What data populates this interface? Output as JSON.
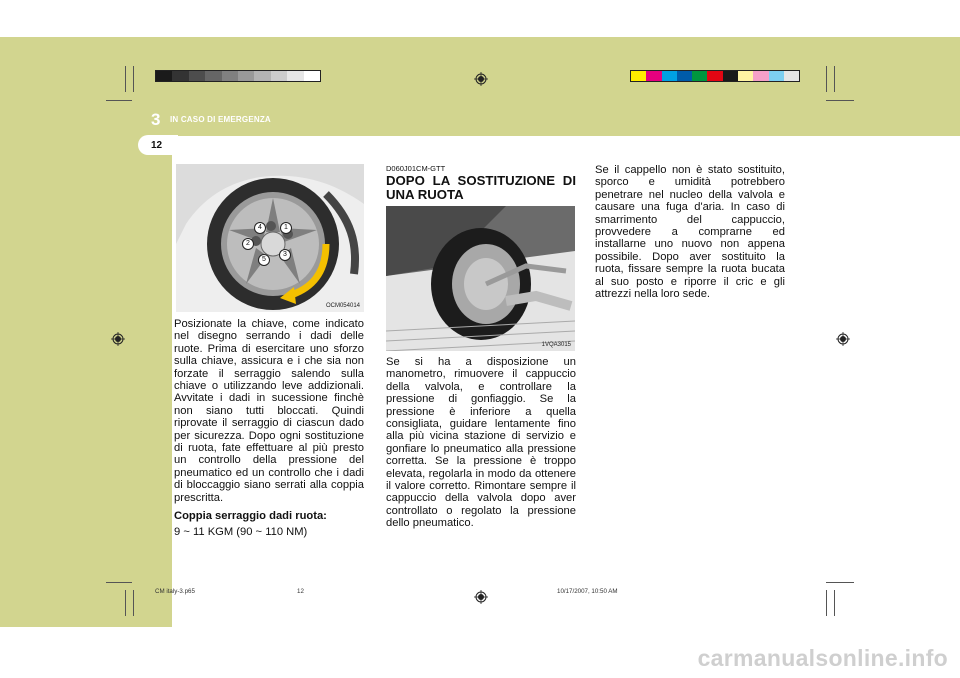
{
  "header": {
    "chapter_number": "3",
    "chapter_title": "IN CASO DI EMERGENZA",
    "page_number": "12"
  },
  "color_bar_left": [
    "#1a1a1a",
    "#333333",
    "#4d4d4d",
    "#666666",
    "#808080",
    "#999999",
    "#b3b3b3",
    "#cccccc",
    "#e6e6e6",
    "#ffffff"
  ],
  "color_bar_right": [
    "#ffed00",
    "#e5007e",
    "#00a0e3",
    "#005ba9",
    "#00963f",
    "#e30613",
    "#1a1a1a",
    "#fff4a3",
    "#f5a0c8",
    "#7dcff1",
    "#e6e6e6"
  ],
  "column1": {
    "figure_label": "OCM054014",
    "body": "Posizionate la chiave, come indicato nel disegno serrando i dadi delle ruote. Prima di esercitare uno sforzo sulla chiave, assicura e i che sia non forzate il serraggio salendo sulla chiave o utilizzando leve addizionali. Avvitate i dadi in sucessione finchè non siano tutti bloccati. Quindi riprovate il serraggio di ciascun dado per sicurezza. Dopo ogni sostituzione di ruota, fate effettuare al più presto un controllo della pressione del pneumatico ed un controllo che i dadi di bloccaggio siano serrati alla coppia prescritta.",
    "torque_heading": "Coppia serraggio dadi ruota:",
    "torque_value": "9 ~ 11 KGM (90 ~ 110 NM)",
    "nut_numbers": [
      "1",
      "2",
      "3",
      "4",
      "5"
    ]
  },
  "column2": {
    "code": "D060J01CM-GTT",
    "title": "DOPO LA SOSTITUZIONE DI UNA RUOTA",
    "figure_label": "1VQA3015",
    "body": "Se si ha a disposizione un manometro, rimuovere il cappuccio della valvola, e controllare la pressione di gonfiaggio. Se la pressione è inferiore a quella consigliata, guidare lentamente fino alla più vicina stazione di servizio e gonfiare lo pneumatico alla pressione corretta. Se la pressione è troppo elevata, regolarla in modo da ottenere il valore corretto. Rimontare sempre il cappuccio della valvola dopo aver controllato o regolato la pressione dello pneumatico."
  },
  "column3": {
    "body": "Se il cappello non è stato sostituito, sporco e umidità potrebbero penetrare nel nucleo della valvola e causare una fuga d'aria. In caso di smarrimento del cappuccio, provvedere a comprarne ed installarne uno nuovo non appena possibile. Dopo aver sostituito la ruota, fissare sempre la ruota bucata al suo posto e riporre il cric e gli attrezzi nella loro sede."
  },
  "footer": {
    "file": "CM italy-3.p65",
    "page": "12",
    "datetime": "10/17/2007, 10:50 AM"
  },
  "watermark": "carmanualsonline.info"
}
